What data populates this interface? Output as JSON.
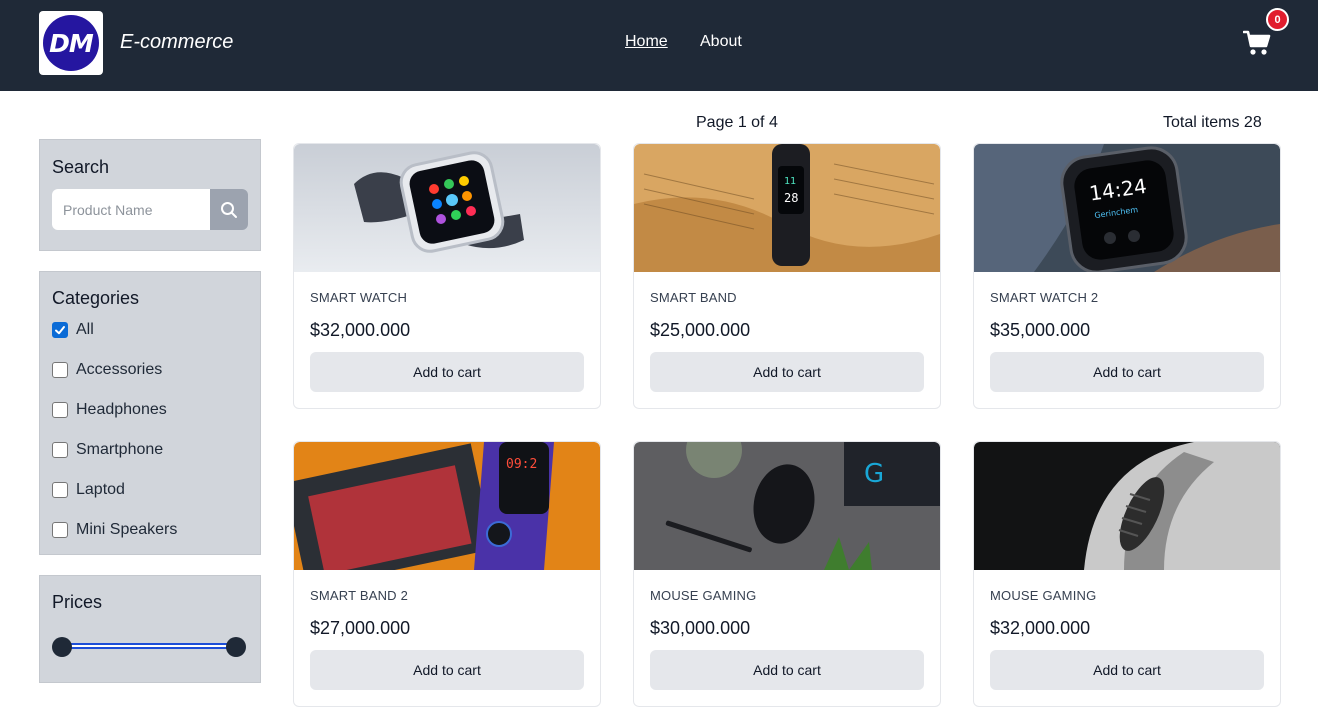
{
  "header": {
    "logo_text": "DM",
    "brand": "E-commerce",
    "nav": [
      {
        "label": "Home",
        "active": true
      },
      {
        "label": "About",
        "active": false
      }
    ],
    "cart_count": "0"
  },
  "pagination": {
    "page_text": "Page 1 of 4",
    "total_text": "Total items 28"
  },
  "search": {
    "title": "Search",
    "placeholder": "Product Name",
    "value": ""
  },
  "categories": {
    "title": "Categories",
    "items": [
      {
        "label": "All",
        "checked": true
      },
      {
        "label": "Accessories",
        "checked": false
      },
      {
        "label": "Headphones",
        "checked": false
      },
      {
        "label": "Smartphone",
        "checked": false
      },
      {
        "label": "Laptod",
        "checked": false
      },
      {
        "label": "Mini Speakers",
        "checked": false
      }
    ]
  },
  "prices": {
    "title": "Prices",
    "range_min_fraction": 0,
    "range_max_fraction": 1
  },
  "products": [
    {
      "name": "SMART WATCH",
      "price": "$32,000.000",
      "button": "Add to cart",
      "image": "smart-watch-image"
    },
    {
      "name": "SMART BAND",
      "price": "$25,000.000",
      "button": "Add to cart",
      "image": "smart-band-image"
    },
    {
      "name": "SMART WATCH 2",
      "price": "$35,000.000",
      "button": "Add to cart",
      "image": "smart-watch-2-image"
    },
    {
      "name": "SMART BAND 2",
      "price": "$27,000.000",
      "button": "Add to cart",
      "image": "smart-band-2-image"
    },
    {
      "name": "MOUSE GAMING",
      "price": "$30,000.000",
      "button": "Add to cart",
      "image": "mouse-gaming-image"
    },
    {
      "name": "MOUSE GAMING",
      "price": "$32,000.000",
      "button": "Add to cart",
      "image": "mouse-gaming-2-image"
    }
  ],
  "colors": {
    "header_bg": "#1f2937",
    "panel_bg": "#d1d5db",
    "badge": "#e11d2e",
    "checkbox_accent": "#0b6bd6",
    "slider_track": "#1d4ed8"
  }
}
